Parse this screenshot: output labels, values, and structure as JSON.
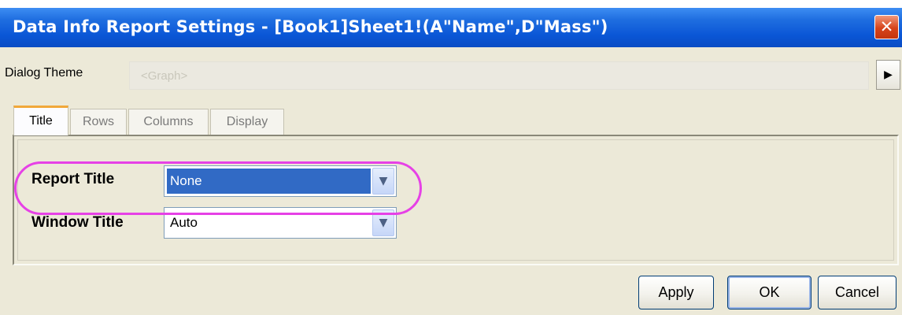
{
  "window": {
    "title": "Data Info Report Settings - [Book1]Sheet1!(A\"Name\",D\"Mass\")",
    "close_glyph": "✕"
  },
  "theme": {
    "label": "Dialog Theme",
    "value": "<Graph>",
    "arrow_glyph": "▶"
  },
  "tabs": [
    {
      "label": "Title",
      "active": true
    },
    {
      "label": "Rows",
      "active": false
    },
    {
      "label": "Columns",
      "active": false
    },
    {
      "label": "Display",
      "active": false
    }
  ],
  "fields": {
    "report_title": {
      "label": "Report Title",
      "value": "None",
      "selected": true
    },
    "window_title": {
      "label": "Window Title",
      "value": "Auto",
      "selected": false
    }
  },
  "dropdown_glyph": "▼",
  "buttons": {
    "apply": "Apply",
    "ok": "OK",
    "cancel": "Cancel"
  },
  "colors": {
    "titlebar": "#0a56d6",
    "selection": "#316ac5",
    "highlight_ring": "#e641e6",
    "active_tab_accent": "#f1a83a"
  },
  "icons": {
    "close": "close-icon",
    "theme_menu": "triangle-right-icon",
    "dropdown": "chevron-down-icon"
  }
}
